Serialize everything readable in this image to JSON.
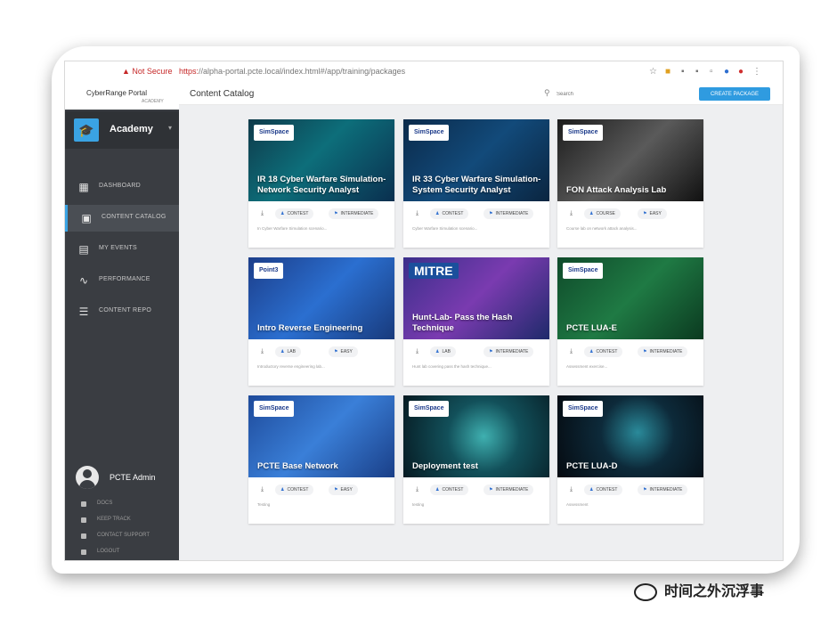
{
  "browser": {
    "security_warning": "Not Secure",
    "url_scheme": "https:",
    "url_rest": "//alpha-portal.pcte.local/index.html#/app/training/packages"
  },
  "sidebar": {
    "brand_title": "CyberRange Portal",
    "brand_sub": "ACADEMY",
    "academy_label": "Academy",
    "items": [
      {
        "label": "DASHBOARD",
        "icon": "dashboard-icon",
        "glyph": "▦"
      },
      {
        "label": "CONTENT CATALOG",
        "icon": "catalog-icon",
        "glyph": "▣"
      },
      {
        "label": "MY EVENTS",
        "icon": "calendar-icon",
        "glyph": "▤"
      },
      {
        "label": "PERFORMANCE",
        "icon": "trend-icon",
        "glyph": "∿"
      },
      {
        "label": "CONTENT REPO",
        "icon": "repo-icon",
        "glyph": "☰"
      }
    ],
    "user_name": "PCTE Admin",
    "user_links": [
      "DOCS",
      "KEEP TRACK",
      "CONTACT SUPPORT",
      "LOGOUT"
    ]
  },
  "header": {
    "title": "Content Catalog",
    "search_placeholder": "Search",
    "create_button": "CREATE PACKAGE"
  },
  "cards": [
    {
      "badge": "SimSpace",
      "title": "IR 18 Cyber Warfare Simulation- Network Security Analyst",
      "pill1": "CONTEST",
      "pill2": "INTERMEDIATE",
      "desc": "In Cyber Warfare Simulation scenario...",
      "bg": "linear-gradient(135deg,#0e3a4a 0%,#0d6e7a 45%,#0a2f4f 100%)"
    },
    {
      "badge": "SimSpace",
      "title": "IR 33 Cyber Warfare Simulation- System Security Analyst",
      "pill1": "CONTEST",
      "pill2": "INTERMEDIATE",
      "desc": "Cyber Warfare Simulation scenario...",
      "bg": "linear-gradient(135deg,#0b2a4a 0%,#124a7a 50%,#0a2540 100%)"
    },
    {
      "badge": "SimSpace",
      "title": "FON Attack Analysis Lab",
      "pill1": "COURSE",
      "pill2": "EASY",
      "desc": "Course lab on network attack analysis...",
      "bg": "linear-gradient(135deg,#1c1c1c 0%,#5a5a5a 50%,#111111 100%)"
    },
    {
      "badge": "Point3",
      "title": "Intro Reverse Engineering",
      "pill1": "LAB",
      "pill2": "EASY",
      "desc": "Introductory reverse engineering lab...",
      "bg": "linear-gradient(135deg,#1c3e8a 0%,#2b6fd0 50%,#183a7c 100%)"
    },
    {
      "badge": "MITRE",
      "title": "Hunt-Lab- Pass the Hash Technique",
      "pill1": "LAB",
      "pill2": "INTERMEDIATE",
      "desc": "Hunt lab covering pass the hash technique...",
      "bg": "linear-gradient(135deg,#3a2f8a 0%,#7a3bb0 50%,#1e2a6a 100%)"
    },
    {
      "badge": "SimSpace",
      "title": "PCTE LUA-E",
      "pill1": "CONTEST",
      "pill2": "INTERMEDIATE",
      "desc": "Assessment exercise...",
      "bg": "linear-gradient(135deg,#0f4a2a 0%,#1f7a44 50%,#0b3a20 100%)"
    },
    {
      "badge": "SimSpace",
      "title": "PCTE Base Network",
      "pill1": "CONTEST",
      "pill2": "EASY",
      "desc": "Testing",
      "bg": "linear-gradient(135deg,#1e4a9a 0%,#3a7fd8 50%,#1a3f88 100%)"
    },
    {
      "badge": "SimSpace",
      "title": "Deployment test",
      "pill1": "CONTEST",
      "pill2": "INTERMEDIATE",
      "desc": "testing",
      "bg": "radial-gradient(circle at 55% 50%,#3fb0b0 0%,#12505a 40%,#061a22 100%)"
    },
    {
      "badge": "SimSpace",
      "title": "PCTE LUA-D",
      "pill1": "CONTEST",
      "pill2": "INTERMEDIATE",
      "desc": "Assessment",
      "bg": "radial-gradient(circle at 55% 45%,#2a8a9a 0%,#0d2a3a 40%,#050a10 100%)"
    }
  ],
  "watermark": "时间之外沉浮事"
}
